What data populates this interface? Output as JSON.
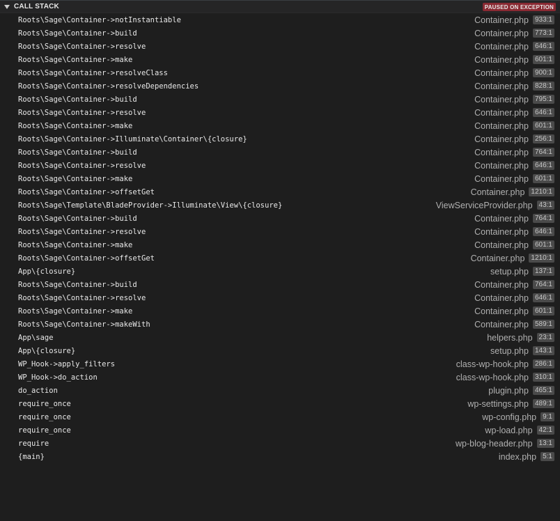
{
  "header": {
    "title": "CALL STACK",
    "badge": "PAUSED ON EXCEPTION",
    "colors": {
      "background": "#252526",
      "badge_bg": "#8a2a33",
      "panel_bg": "#1e1e1e"
    }
  },
  "frames": [
    {
      "fn": "Roots\\Sage\\Container->notInstantiable",
      "file": "Container.php",
      "line": "933:1"
    },
    {
      "fn": "Roots\\Sage\\Container->build",
      "file": "Container.php",
      "line": "773:1"
    },
    {
      "fn": "Roots\\Sage\\Container->resolve",
      "file": "Container.php",
      "line": "646:1"
    },
    {
      "fn": "Roots\\Sage\\Container->make",
      "file": "Container.php",
      "line": "601:1"
    },
    {
      "fn": "Roots\\Sage\\Container->resolveClass",
      "file": "Container.php",
      "line": "900:1"
    },
    {
      "fn": "Roots\\Sage\\Container->resolveDependencies",
      "file": "Container.php",
      "line": "828:1"
    },
    {
      "fn": "Roots\\Sage\\Container->build",
      "file": "Container.php",
      "line": "795:1"
    },
    {
      "fn": "Roots\\Sage\\Container->resolve",
      "file": "Container.php",
      "line": "646:1"
    },
    {
      "fn": "Roots\\Sage\\Container->make",
      "file": "Container.php",
      "line": "601:1"
    },
    {
      "fn": "Roots\\Sage\\Container->Illuminate\\Container\\{closure}",
      "file": "Container.php",
      "line": "256:1"
    },
    {
      "fn": "Roots\\Sage\\Container->build",
      "file": "Container.php",
      "line": "764:1"
    },
    {
      "fn": "Roots\\Sage\\Container->resolve",
      "file": "Container.php",
      "line": "646:1"
    },
    {
      "fn": "Roots\\Sage\\Container->make",
      "file": "Container.php",
      "line": "601:1"
    },
    {
      "fn": "Roots\\Sage\\Container->offsetGet",
      "file": "Container.php",
      "line": "1210:1"
    },
    {
      "fn": "Roots\\Sage\\Template\\BladeProvider->Illuminate\\View\\{closure}",
      "file": "ViewServiceProvider.php",
      "line": "43:1"
    },
    {
      "fn": "Roots\\Sage\\Container->build",
      "file": "Container.php",
      "line": "764:1"
    },
    {
      "fn": "Roots\\Sage\\Container->resolve",
      "file": "Container.php",
      "line": "646:1"
    },
    {
      "fn": "Roots\\Sage\\Container->make",
      "file": "Container.php",
      "line": "601:1"
    },
    {
      "fn": "Roots\\Sage\\Container->offsetGet",
      "file": "Container.php",
      "line": "1210:1"
    },
    {
      "fn": "App\\{closure}",
      "file": "setup.php",
      "line": "137:1"
    },
    {
      "fn": "Roots\\Sage\\Container->build",
      "file": "Container.php",
      "line": "764:1"
    },
    {
      "fn": "Roots\\Sage\\Container->resolve",
      "file": "Container.php",
      "line": "646:1"
    },
    {
      "fn": "Roots\\Sage\\Container->make",
      "file": "Container.php",
      "line": "601:1"
    },
    {
      "fn": "Roots\\Sage\\Container->makeWith",
      "file": "Container.php",
      "line": "589:1"
    },
    {
      "fn": "App\\sage",
      "file": "helpers.php",
      "line": "23:1"
    },
    {
      "fn": "App\\{closure}",
      "file": "setup.php",
      "line": "143:1"
    },
    {
      "fn": "WP_Hook->apply_filters",
      "file": "class-wp-hook.php",
      "line": "286:1"
    },
    {
      "fn": "WP_Hook->do_action",
      "file": "class-wp-hook.php",
      "line": "310:1"
    },
    {
      "fn": "do_action",
      "file": "plugin.php",
      "line": "465:1"
    },
    {
      "fn": "require_once",
      "file": "wp-settings.php",
      "line": "489:1"
    },
    {
      "fn": "require_once",
      "file": "wp-config.php",
      "line": "9:1"
    },
    {
      "fn": "require_once",
      "file": "wp-load.php",
      "line": "42:1"
    },
    {
      "fn": "require",
      "file": "wp-blog-header.php",
      "line": "13:1"
    },
    {
      "fn": "{main}",
      "file": "index.php",
      "line": "5:1"
    }
  ]
}
